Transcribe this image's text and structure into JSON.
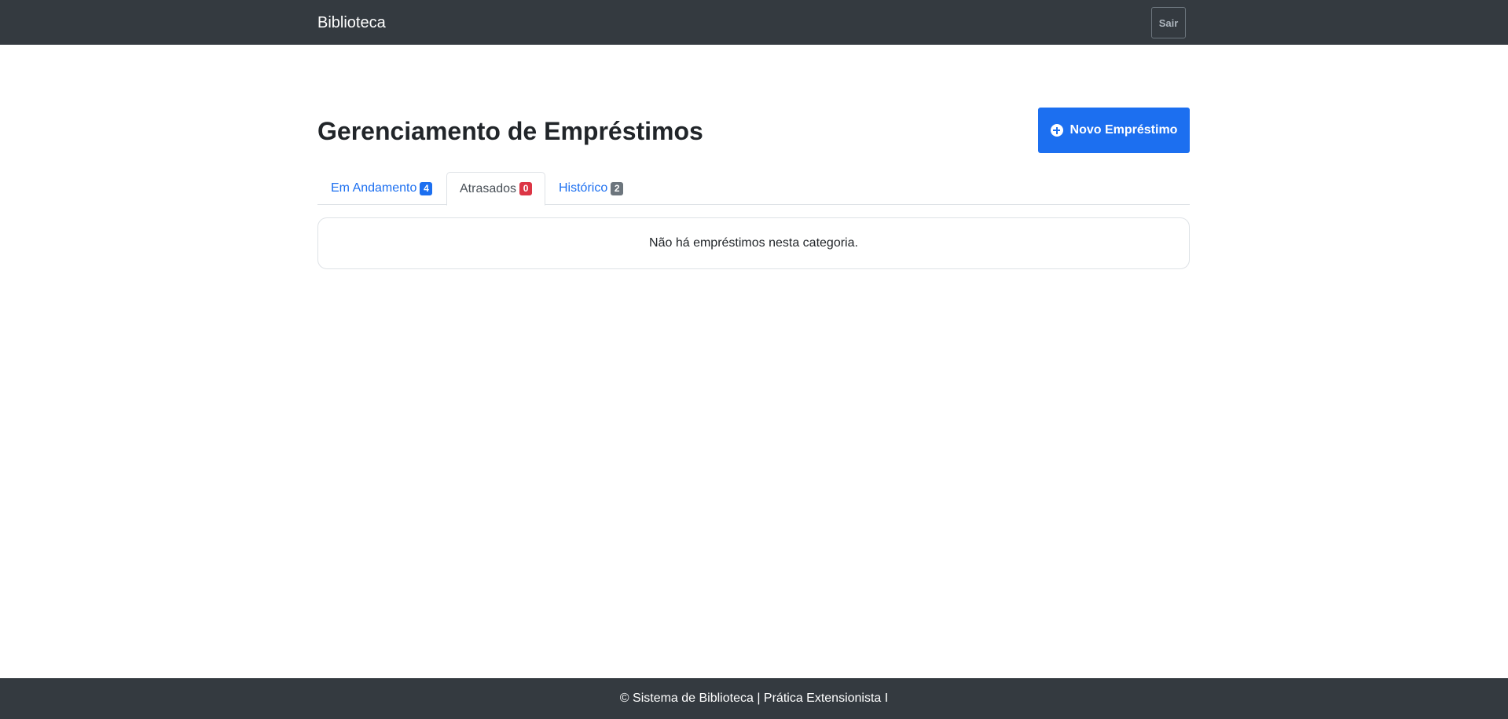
{
  "navbar": {
    "brand": "Biblioteca",
    "logout_label": "Sair"
  },
  "page": {
    "title": "Gerenciamento de Empréstimos",
    "new_loan_label": "Novo Empréstimo",
    "new_loan_icon": "plus-circle-icon"
  },
  "tabs": [
    {
      "label": "Em Andamento",
      "count": "4",
      "badge_color": "#1c6ff0",
      "active": false
    },
    {
      "label": "Atrasados",
      "count": "0",
      "badge_color": "#dc3545",
      "active": true
    },
    {
      "label": "Histórico",
      "count": "2",
      "badge_color": "#6c757d",
      "active": false
    }
  ],
  "empty_state": {
    "message": "Não há empréstimos nesta categoria."
  },
  "footer": {
    "text": "© Sistema de Biblioteca | Prática Extensionista I"
  },
  "colors": {
    "navbar_bg": "#343a40",
    "primary": "#1c6ff0",
    "danger": "#dc3545",
    "secondary": "#6c757d"
  }
}
